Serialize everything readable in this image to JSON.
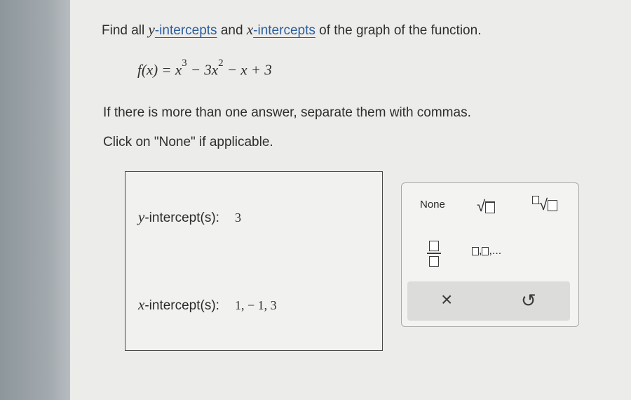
{
  "question": {
    "line1_prefix": "Find all ",
    "y_var": "y",
    "intercepts_link": "-intercepts",
    "and": " and ",
    "x_var": "x",
    "line1_suffix": " of the graph of the function.",
    "line2": "If there is more than one answer, separate them with commas.",
    "line3": "Click on \"None\" if applicable."
  },
  "formula": {
    "lhs": "f(x) = x",
    "exp3": "3",
    "mid": " − 3x",
    "exp2": "2",
    "rhs": " − x + 3"
  },
  "answers": {
    "y_var": "y",
    "y_label": "-intercept(s):",
    "y_value": "3",
    "x_var": "x",
    "x_label": "-intercept(s):",
    "x_value": "1, − 1, 3"
  },
  "palette": {
    "none_label": "None",
    "sqrt_icon": "square-root-icon",
    "nth_root_icon": "nth-root-icon",
    "fraction_icon": "fraction-icon",
    "list_suffix": ",...",
    "clear_symbol": "×",
    "undo_symbol": "↺"
  }
}
